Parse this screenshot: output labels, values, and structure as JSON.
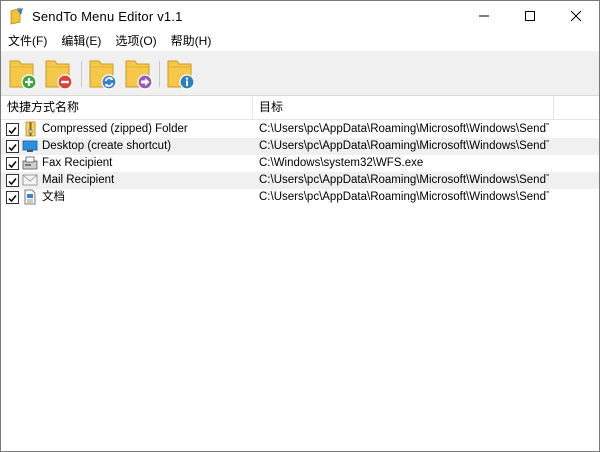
{
  "window": {
    "title": "SendTo Menu Editor v1.1",
    "app_icon": "sendto-app-icon",
    "controls": {
      "minimize": "minimize-icon",
      "maximize": "maximize-icon",
      "close": "close-icon"
    }
  },
  "menu": {
    "items": [
      {
        "label": "文件(F)"
      },
      {
        "label": "编辑(E)"
      },
      {
        "label": "选项(O)"
      },
      {
        "label": "帮助(H)"
      }
    ]
  },
  "toolbar": {
    "buttons": [
      {
        "icon": "folder-add-icon"
      },
      {
        "icon": "folder-remove-icon"
      },
      {
        "icon": "folder-refresh-icon"
      },
      {
        "icon": "folder-move-icon"
      },
      {
        "icon": "folder-info-icon"
      }
    ]
  },
  "list": {
    "columns": {
      "name": "快捷方式名称",
      "target": "目标"
    },
    "rows": [
      {
        "checked": true,
        "icon": "zip-folder-icon",
        "name": "Compressed (zipped) Folder",
        "target": "C:\\Users\\pc\\AppData\\Roaming\\Microsoft\\Windows\\SendT..."
      },
      {
        "checked": true,
        "icon": "desktop-icon",
        "name": "Desktop (create shortcut)",
        "target": "C:\\Users\\pc\\AppData\\Roaming\\Microsoft\\Windows\\SendT..."
      },
      {
        "checked": true,
        "icon": "fax-icon",
        "name": "Fax Recipient",
        "target": "C:\\Windows\\system32\\WFS.exe"
      },
      {
        "checked": true,
        "icon": "mail-icon",
        "name": "Mail Recipient",
        "target": "C:\\Users\\pc\\AppData\\Roaming\\Microsoft\\Windows\\SendT..."
      },
      {
        "checked": true,
        "icon": "document-icon",
        "name": "文档",
        "target": "C:\\Users\\pc\\AppData\\Roaming\\Microsoft\\Windows\\SendT..."
      }
    ]
  },
  "colors": {
    "folder": "#f5c84c",
    "add": "#3ca53c",
    "remove": "#d9443a",
    "refresh": "#3a7fc8",
    "move": "#9b59b6",
    "info": "#2f7fbf"
  }
}
